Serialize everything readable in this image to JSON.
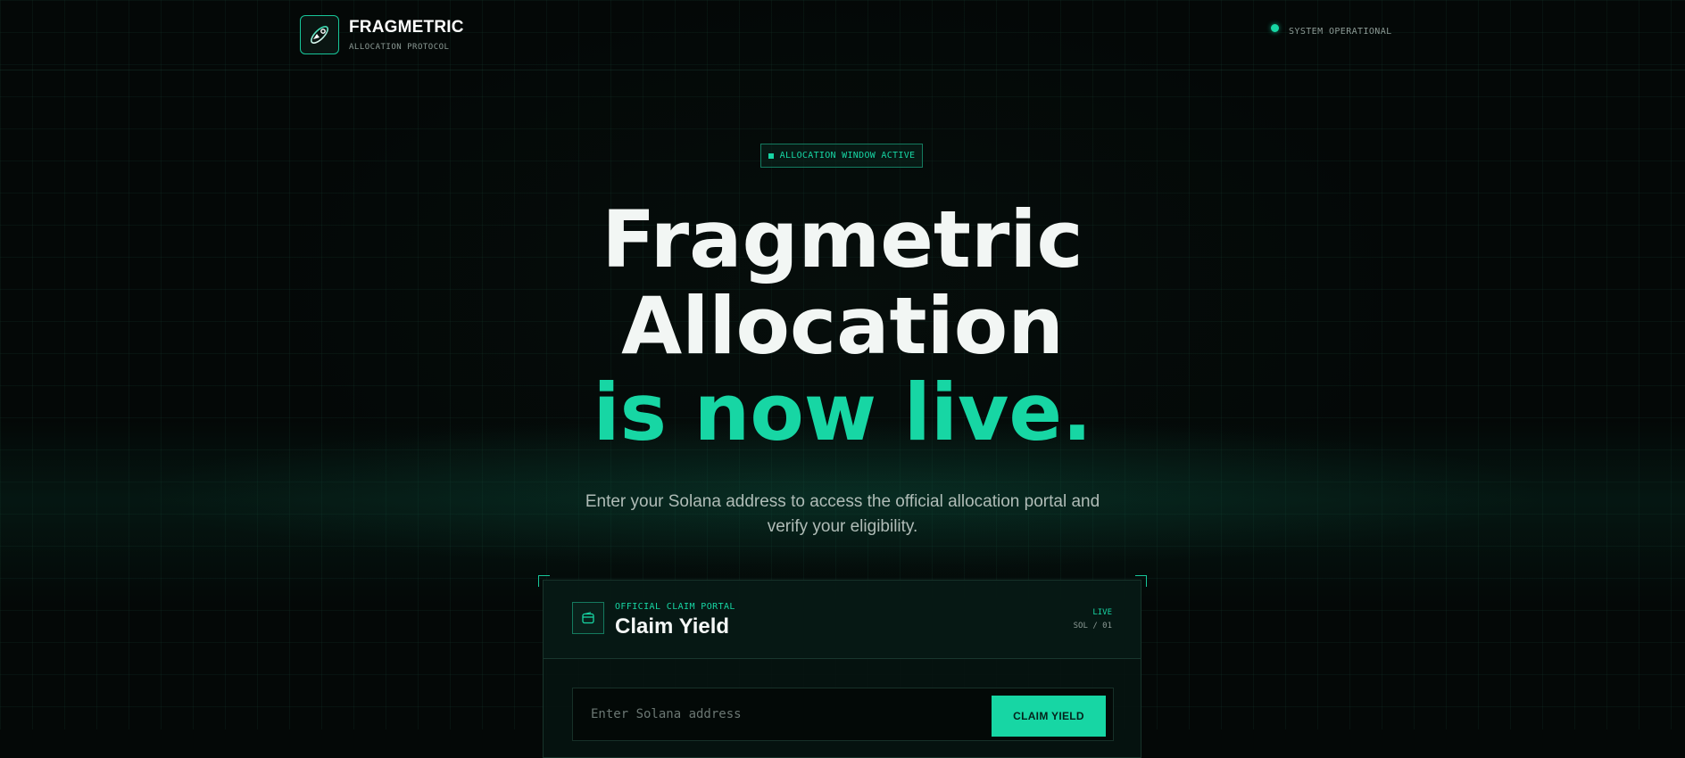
{
  "header": {
    "brand_name": "FRAGMETRIC",
    "brand_sub": "ALLOCATION PROTOCOL",
    "status_text": "SYSTEM OPERATIONAL",
    "logo_icon": "orbit-logo-icon"
  },
  "badge": {
    "text": "ALLOCATION WINDOW ACTIVE"
  },
  "hero": {
    "line1": "Fragmetric",
    "line2": "Allocation",
    "line3": "is now live.",
    "description": "Enter your Solana address to access the official allocation portal and verify your eligibility."
  },
  "card": {
    "eyebrow": "OFFICIAL CLAIM PORTAL",
    "title": "Claim Yield",
    "live_label": "LIVE",
    "meta": "SOL / 01",
    "icon": "wallet-icon",
    "input_placeholder": "Enter Solana address",
    "input_value": "",
    "button_label": "CLAIM YIELD"
  },
  "colors": {
    "accent": "#17d6a4",
    "background": "#040807",
    "text": "#f2f6f4",
    "muted": "#8c9a95"
  }
}
